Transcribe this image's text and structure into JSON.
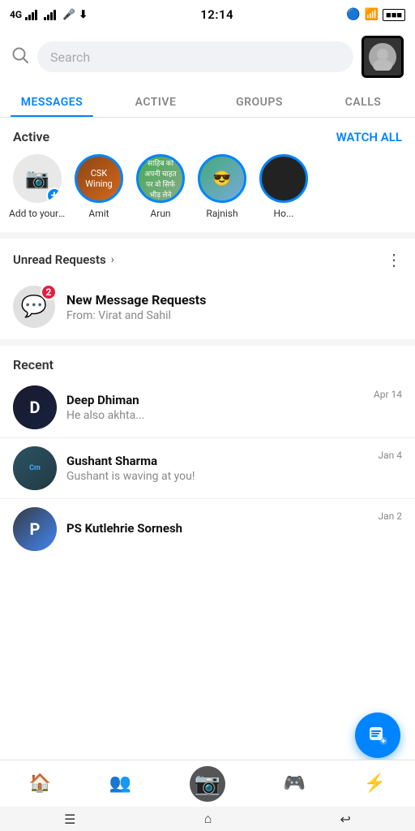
{
  "statusBar": {
    "network": "4G",
    "time": "12:14",
    "icons": [
      "bluetooth",
      "wifi",
      "battery"
    ]
  },
  "header": {
    "searchPlaceholder": "Search"
  },
  "tabs": [
    {
      "id": "messages",
      "label": "MESSAGES",
      "active": true
    },
    {
      "id": "active",
      "label": "ACTIVE",
      "active": false
    },
    {
      "id": "groups",
      "label": "GROUPS",
      "active": false
    },
    {
      "id": "calls",
      "label": "CALLS",
      "active": false
    }
  ],
  "activeSection": {
    "title": "Active",
    "watchAllLabel": "WATCH ALL",
    "addDayLabel": "Add to your day",
    "users": [
      {
        "name": "Amit",
        "avatarClass": "avatar-amit"
      },
      {
        "name": "Arun",
        "avatarClass": "avatar-arun"
      },
      {
        "name": "Rajnish",
        "avatarClass": "avatar-rajnish"
      },
      {
        "name": "Ho...",
        "avatarClass": "avatar-ho"
      }
    ]
  },
  "unreadRequests": {
    "title": "Unread Requests",
    "badgeCount": "2",
    "requestTitle": "New Message Requests",
    "requestSubtitle": "From: Virat and Sahil"
  },
  "recentSection": {
    "title": "Recent",
    "conversations": [
      {
        "name": "Deep Dhiman",
        "message": "He also akhta...",
        "time": "Apr 14",
        "avatarClass": "conv-avatar-deep"
      },
      {
        "name": "Gushant Sharma",
        "message": "Gushant is waving at you!",
        "time": "Jan 4",
        "avatarClass": "conv-avatar-gushant"
      },
      {
        "name": "PS Kutlehrie Sornesh",
        "message": "",
        "time": "Jan 2",
        "avatarClass": "conv-avatar-ps"
      }
    ]
  },
  "bottomNav": [
    {
      "id": "home",
      "icon": "🏠",
      "active": true
    },
    {
      "id": "people",
      "icon": "👥",
      "active": false
    },
    {
      "id": "camera",
      "icon": "📷",
      "active": false
    },
    {
      "id": "games",
      "icon": "🎮",
      "active": false
    },
    {
      "id": "lightning",
      "icon": "⚡",
      "active": false
    }
  ],
  "sysNav": {
    "menu": "☰",
    "home": "⌂",
    "back": "↩"
  }
}
